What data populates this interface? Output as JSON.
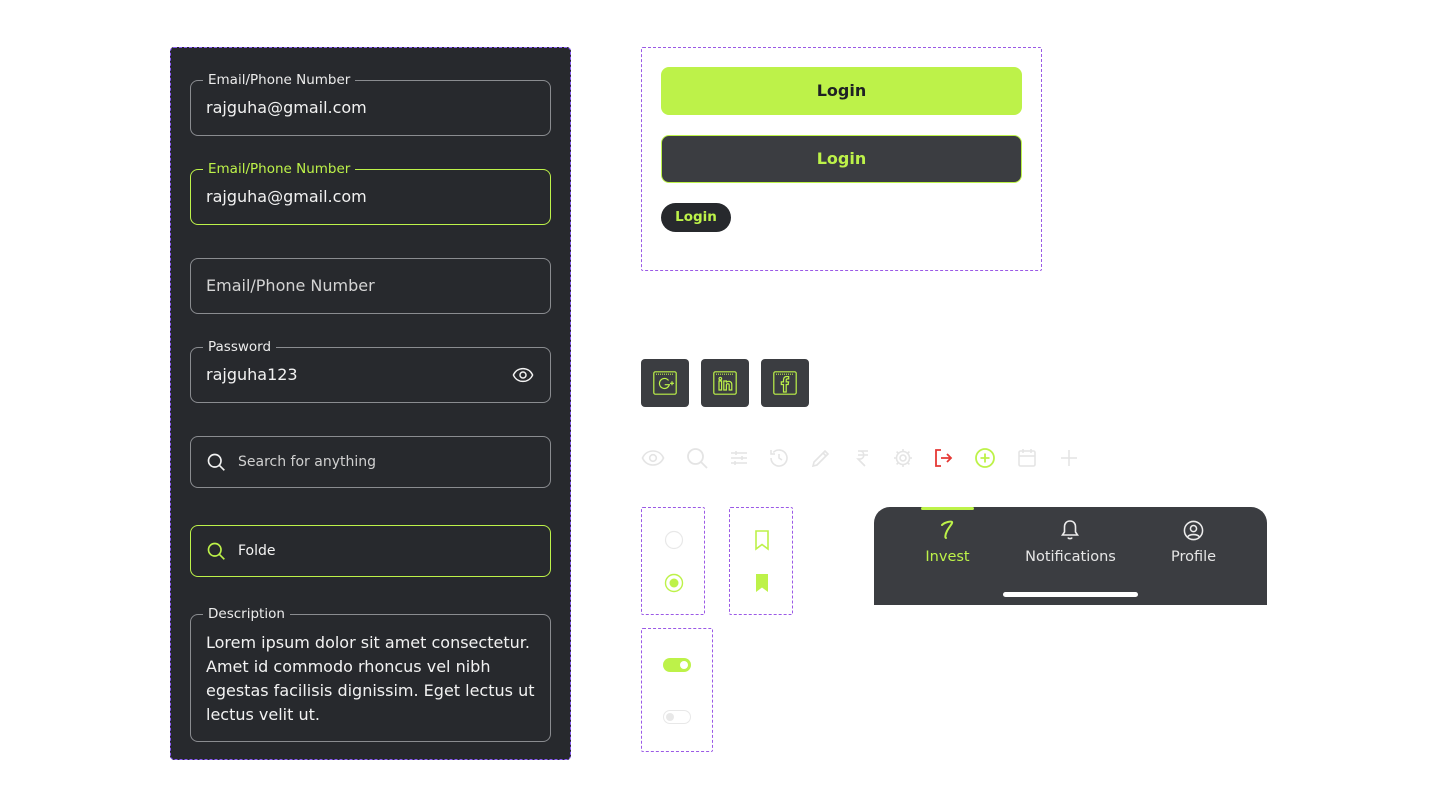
{
  "colors": {
    "accent": "#bdf249",
    "panel_dark": "#27292d",
    "surface": "#3b3d41",
    "border": "#8a8c90",
    "danger": "#e53935",
    "dashed_outline": "#9b59e6"
  },
  "form": {
    "email_filled": {
      "label": "Email/Phone Number",
      "value": "rajguha@gmail.com"
    },
    "email_focused": {
      "label": "Email/Phone Number",
      "value": "rajguha@gmail.com"
    },
    "email_empty": {
      "placeholder": "Email/Phone Number"
    },
    "password": {
      "label": "Password",
      "value": "rajguha123",
      "icon": "eye-icon"
    },
    "search_empty": {
      "placeholder": "Search for anything",
      "icon": "search-icon"
    },
    "search_active": {
      "value": "Folde",
      "icon": "search-icon"
    },
    "description": {
      "label": "Description",
      "value": "Lorem ipsum dolor sit amet consectetur. Amet id commodo rhoncus vel nibh egestas facilisis dignissim. Eget lectus ut lectus velit ut."
    }
  },
  "buttons": {
    "primary_label": "Login",
    "secondary_label": "Login",
    "small_label": "Login"
  },
  "social": [
    "google-icon",
    "linkedin-icon",
    "facebook-icon"
  ],
  "icon_strip": [
    "eye-icon",
    "search-icon",
    "filter-sliders-icon",
    "history-icon",
    "pencil-icon",
    "rupee-icon",
    "gear-icon",
    "logout-icon",
    "add-circle-icon",
    "calendar-icon",
    "plus-icon"
  ],
  "radios": {
    "unchecked": false,
    "checked": true
  },
  "bookmarks": {
    "outline": "bookmark-outline-icon",
    "filled": "bookmark-filled-icon"
  },
  "toggles": {
    "on": true,
    "off": false
  },
  "bottom_nav": {
    "items": [
      {
        "label": "Invest",
        "icon": "invest-icon",
        "active": true
      },
      {
        "label": "Notifications",
        "icon": "bell-icon",
        "active": false
      },
      {
        "label": "Profile",
        "icon": "profile-icon",
        "active": false
      }
    ]
  }
}
